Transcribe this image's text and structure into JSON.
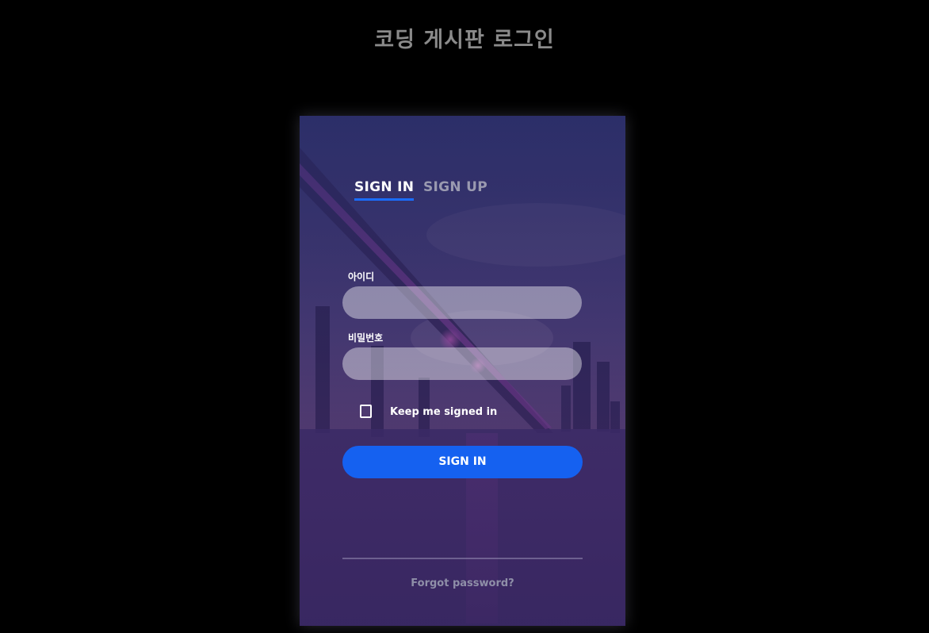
{
  "page": {
    "title": "코딩 게시판 로그인"
  },
  "tabs": [
    {
      "label": "SIGN IN",
      "active": true
    },
    {
      "label": "SIGN UP",
      "active": false
    }
  ],
  "form": {
    "id_label": "아이디",
    "id_value": "",
    "password_label": "비밀번호",
    "password_value": "",
    "keep_signed_in_label": "Keep me signed in",
    "keep_signed_in_checked": false,
    "submit_label": "SIGN IN"
  },
  "footer": {
    "forgot_label": "Forgot password?"
  },
  "colors": {
    "background": "#000000",
    "title": "#8a8a8a",
    "accent": "#1561f0",
    "tab_underline": "#1a6dff",
    "inactive_tab": "#9a9ab0"
  }
}
